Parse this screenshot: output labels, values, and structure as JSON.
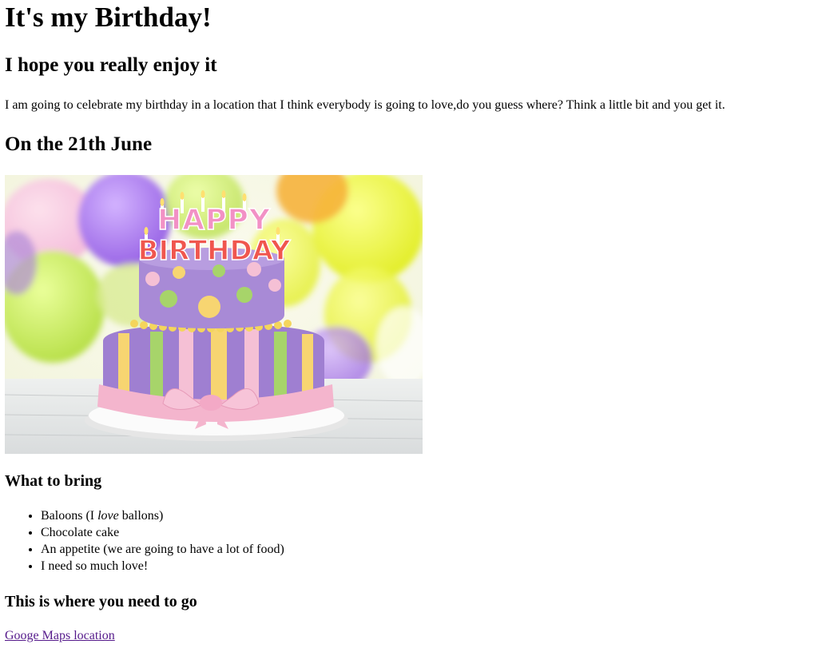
{
  "page": {
    "title": "It's my Birthday!",
    "subtitle": "I hope you really enjoy it",
    "intro": "I am going to celebrate my birthday in a location that I think everybody is going to love,do you guess where? Think a little bit and you get it.",
    "date_heading": "On the 21th June"
  },
  "image": {
    "cake_text_top": "HAPPY",
    "cake_text_bottom": "BIRTHDAY",
    "colors": {
      "cake_purple": "#9b82c8",
      "frosting_pink": "#f3b6cf",
      "stripe_yellow": "#f4d36b",
      "stripe_green": "#a8d67a"
    }
  },
  "bring": {
    "heading": "What to bring",
    "items": [
      {
        "before": "Baloons (I ",
        "emphasis": "love",
        "after": " ballons)"
      },
      {
        "text": "Chocolate cake"
      },
      {
        "text": "An appetite (we are going to have a lot of food)"
      },
      {
        "text": "I need so much love!"
      }
    ]
  },
  "location": {
    "heading": "This is where you need to go",
    "link_text": "Googe Maps location"
  }
}
